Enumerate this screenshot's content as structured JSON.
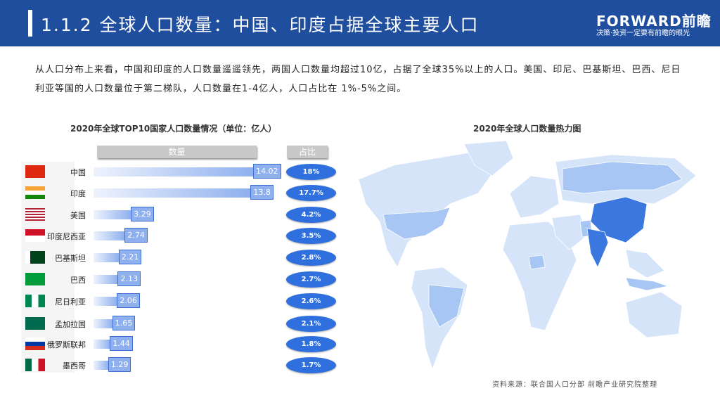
{
  "header": {
    "title": "1.1.2 全球人口数量：中国、印度占据全球主要人口",
    "logo": "FORWARD前瞻",
    "slogan": "决策·投资一定要有前瞻的眼光"
  },
  "intro": "从人口分布上来看，中国和印度的人口数量遥遥领先，两国人口数量均超过10亿，占据了全球35%以上的人口。美国、印尼、巴基斯坦、巴西、尼日利亚等国的人口数量位于第二梯队，人口数量在1-4亿人，人口占比在 1%-5%之间。",
  "chart_data": {
    "type": "bar",
    "title": "2020年全球TOP10国家人口数量情况（单位：亿人）",
    "col_value": "数量",
    "col_share": "占比",
    "categories": [
      "中国",
      "印度",
      "美国",
      "印度尼西亚",
      "巴基斯坦",
      "巴西",
      "尼日利亚",
      "孟加拉国",
      "俄罗斯联邦",
      "墨西哥"
    ],
    "values": [
      14.02,
      13.8,
      3.29,
      2.74,
      2.21,
      2.13,
      2.06,
      1.65,
      1.44,
      1.29
    ],
    "value_labels": [
      "14.02",
      "13.8",
      "3.29",
      "2.74",
      "2.21",
      "2.13",
      "2.06",
      "1.65",
      "1.44",
      "1.29"
    ],
    "shares": [
      "18%",
      "17.7%",
      "4.2%",
      "3.5%",
      "2.8%",
      "2.7%",
      "2.6%",
      "2.1%",
      "1.8%",
      "1.7%"
    ]
  },
  "map": {
    "title": "2020年全球人口数量热力图",
    "colors": {
      "high": "#3a78e0",
      "mid": "#a8c6f3",
      "low": "#d6e4fa"
    }
  },
  "source": "资料来源：联合国人口分部 前瞻产业研究院整理"
}
